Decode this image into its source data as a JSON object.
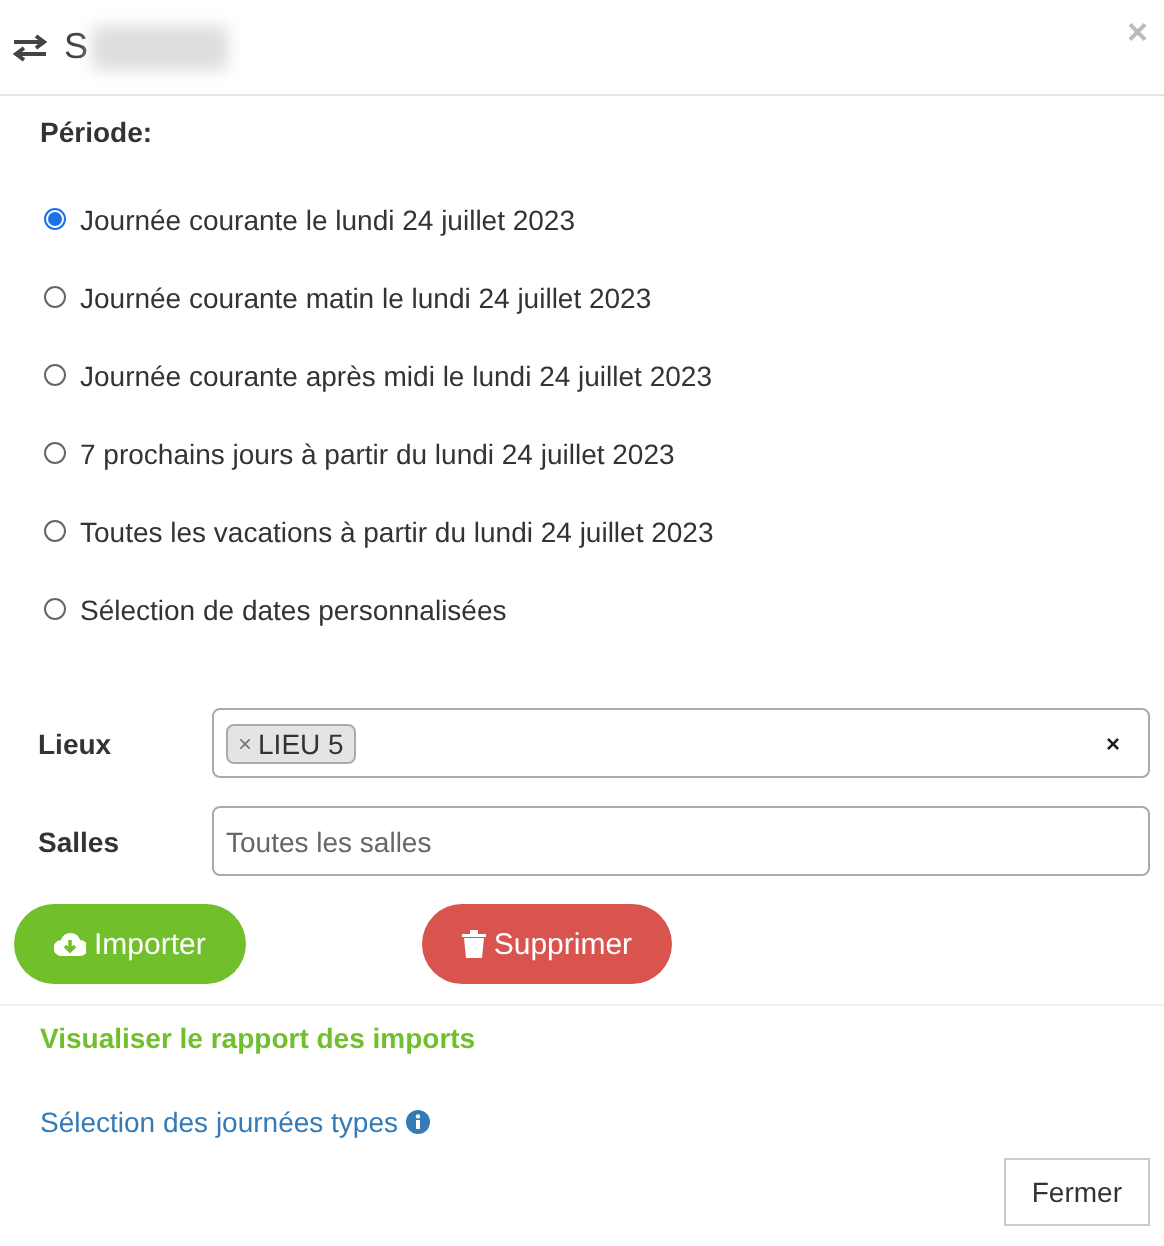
{
  "header": {
    "title": "S",
    "redacted": true,
    "close": "×"
  },
  "period": {
    "label": "Période:",
    "options": [
      {
        "label": "Journée courante le lundi 24 juillet 2023",
        "selected": true
      },
      {
        "label": "Journée courante matin le lundi 24 juillet 2023",
        "selected": false
      },
      {
        "label": "Journée courante après midi le lundi 24 juillet 2023",
        "selected": false
      },
      {
        "label": "7 prochains jours à partir du lundi 24 juillet 2023",
        "selected": false
      },
      {
        "label": "Toutes les vacations à partir du lundi 24 juillet 2023",
        "selected": false
      },
      {
        "label": "Sélection de dates personnalisées",
        "selected": false
      }
    ]
  },
  "lieux": {
    "label": "Lieux",
    "tags": [
      {
        "remove": "×",
        "label": "LIEU 5"
      }
    ],
    "clear": "×"
  },
  "salles": {
    "label": "Salles",
    "placeholder": "Toutes les salles"
  },
  "buttons": [
    {
      "kind": "import",
      "label": "Importer"
    },
    {
      "kind": "delete",
      "label": "Supprimer"
    }
  ],
  "report_link": "Visualiser le rapport des imports",
  "day_types_link": "Sélection des journées types",
  "close_button": "Fermer"
}
